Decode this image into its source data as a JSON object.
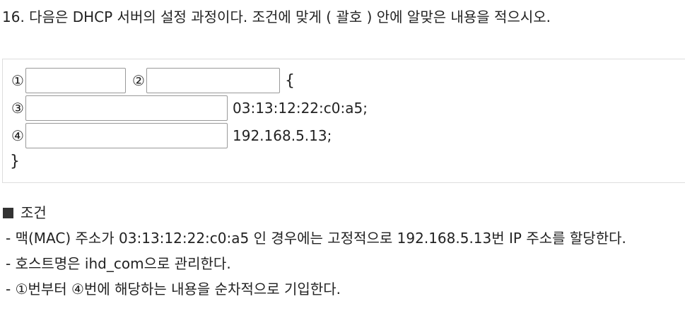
{
  "question": {
    "text": "16. 다음은 DHCP 서버의 설정 과정이다. 조건에 맞게 ( 괄호 ) 안에 알맞은 내용을 적으시오."
  },
  "code": {
    "markers": [
      "①",
      "②",
      "③",
      "④"
    ],
    "open_brace": "{",
    "line3_value": "03:13:12:22:c0:a5;",
    "line4_value": "192.168.5.13;",
    "close_brace": "}",
    "blanks": [
      "",
      "",
      "",
      ""
    ]
  },
  "conditions": {
    "title": "조건",
    "items": [
      "- 맥(MAC) 주소가 03:13:12:22:c0:a5 인 경우에는 고정적으로 192.168.5.13번 IP 주소를 할당한다.",
      "- 호스트명은 ihd_com으로 관리한다.",
      "- ①번부터 ④번에 해당하는 내용을 순차적으로 기입한다."
    ]
  }
}
